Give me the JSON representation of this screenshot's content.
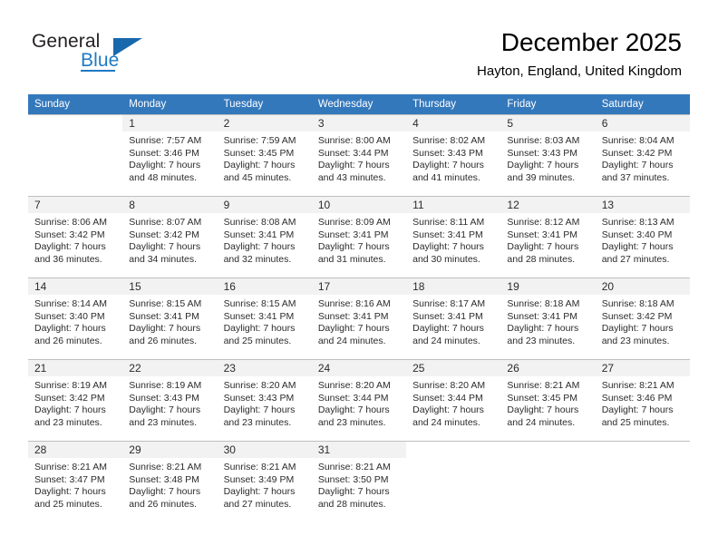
{
  "brand": {
    "name_part1": "General",
    "name_part2": "Blue",
    "logo_icon": "triangle-logo-icon",
    "accent_color": "#1868ad"
  },
  "header": {
    "month_title": "December 2025",
    "location": "Hayton, England, United Kingdom"
  },
  "theme": {
    "header_row_bg": "#3478bc",
    "header_row_text": "#ffffff",
    "daynum_bar_bg": "#f2f2f2",
    "grid_line": "#c8c8c8",
    "body_text": "#2b2b2b"
  },
  "weekday_headers": [
    "Sunday",
    "Monday",
    "Tuesday",
    "Wednesday",
    "Thursday",
    "Friday",
    "Saturday"
  ],
  "weeks": [
    [
      {
        "day": "",
        "empty": true,
        "sunrise": "",
        "sunset": "",
        "daylight_line1": "",
        "daylight_line2": ""
      },
      {
        "day": "1",
        "empty": false,
        "sunrise": "Sunrise: 7:57 AM",
        "sunset": "Sunset: 3:46 PM",
        "daylight_line1": "Daylight: 7 hours",
        "daylight_line2": "and 48 minutes."
      },
      {
        "day": "2",
        "empty": false,
        "sunrise": "Sunrise: 7:59 AM",
        "sunset": "Sunset: 3:45 PM",
        "daylight_line1": "Daylight: 7 hours",
        "daylight_line2": "and 45 minutes."
      },
      {
        "day": "3",
        "empty": false,
        "sunrise": "Sunrise: 8:00 AM",
        "sunset": "Sunset: 3:44 PM",
        "daylight_line1": "Daylight: 7 hours",
        "daylight_line2": "and 43 minutes."
      },
      {
        "day": "4",
        "empty": false,
        "sunrise": "Sunrise: 8:02 AM",
        "sunset": "Sunset: 3:43 PM",
        "daylight_line1": "Daylight: 7 hours",
        "daylight_line2": "and 41 minutes."
      },
      {
        "day": "5",
        "empty": false,
        "sunrise": "Sunrise: 8:03 AM",
        "sunset": "Sunset: 3:43 PM",
        "daylight_line1": "Daylight: 7 hours",
        "daylight_line2": "and 39 minutes."
      },
      {
        "day": "6",
        "empty": false,
        "sunrise": "Sunrise: 8:04 AM",
        "sunset": "Sunset: 3:42 PM",
        "daylight_line1": "Daylight: 7 hours",
        "daylight_line2": "and 37 minutes."
      }
    ],
    [
      {
        "day": "7",
        "empty": false,
        "sunrise": "Sunrise: 8:06 AM",
        "sunset": "Sunset: 3:42 PM",
        "daylight_line1": "Daylight: 7 hours",
        "daylight_line2": "and 36 minutes."
      },
      {
        "day": "8",
        "empty": false,
        "sunrise": "Sunrise: 8:07 AM",
        "sunset": "Sunset: 3:42 PM",
        "daylight_line1": "Daylight: 7 hours",
        "daylight_line2": "and 34 minutes."
      },
      {
        "day": "9",
        "empty": false,
        "sunrise": "Sunrise: 8:08 AM",
        "sunset": "Sunset: 3:41 PM",
        "daylight_line1": "Daylight: 7 hours",
        "daylight_line2": "and 32 minutes."
      },
      {
        "day": "10",
        "empty": false,
        "sunrise": "Sunrise: 8:09 AM",
        "sunset": "Sunset: 3:41 PM",
        "daylight_line1": "Daylight: 7 hours",
        "daylight_line2": "and 31 minutes."
      },
      {
        "day": "11",
        "empty": false,
        "sunrise": "Sunrise: 8:11 AM",
        "sunset": "Sunset: 3:41 PM",
        "daylight_line1": "Daylight: 7 hours",
        "daylight_line2": "and 30 minutes."
      },
      {
        "day": "12",
        "empty": false,
        "sunrise": "Sunrise: 8:12 AM",
        "sunset": "Sunset: 3:41 PM",
        "daylight_line1": "Daylight: 7 hours",
        "daylight_line2": "and 28 minutes."
      },
      {
        "day": "13",
        "empty": false,
        "sunrise": "Sunrise: 8:13 AM",
        "sunset": "Sunset: 3:40 PM",
        "daylight_line1": "Daylight: 7 hours",
        "daylight_line2": "and 27 minutes."
      }
    ],
    [
      {
        "day": "14",
        "empty": false,
        "sunrise": "Sunrise: 8:14 AM",
        "sunset": "Sunset: 3:40 PM",
        "daylight_line1": "Daylight: 7 hours",
        "daylight_line2": "and 26 minutes."
      },
      {
        "day": "15",
        "empty": false,
        "sunrise": "Sunrise: 8:15 AM",
        "sunset": "Sunset: 3:41 PM",
        "daylight_line1": "Daylight: 7 hours",
        "daylight_line2": "and 26 minutes."
      },
      {
        "day": "16",
        "empty": false,
        "sunrise": "Sunrise: 8:15 AM",
        "sunset": "Sunset: 3:41 PM",
        "daylight_line1": "Daylight: 7 hours",
        "daylight_line2": "and 25 minutes."
      },
      {
        "day": "17",
        "empty": false,
        "sunrise": "Sunrise: 8:16 AM",
        "sunset": "Sunset: 3:41 PM",
        "daylight_line1": "Daylight: 7 hours",
        "daylight_line2": "and 24 minutes."
      },
      {
        "day": "18",
        "empty": false,
        "sunrise": "Sunrise: 8:17 AM",
        "sunset": "Sunset: 3:41 PM",
        "daylight_line1": "Daylight: 7 hours",
        "daylight_line2": "and 24 minutes."
      },
      {
        "day": "19",
        "empty": false,
        "sunrise": "Sunrise: 8:18 AM",
        "sunset": "Sunset: 3:41 PM",
        "daylight_line1": "Daylight: 7 hours",
        "daylight_line2": "and 23 minutes."
      },
      {
        "day": "20",
        "empty": false,
        "sunrise": "Sunrise: 8:18 AM",
        "sunset": "Sunset: 3:42 PM",
        "daylight_line1": "Daylight: 7 hours",
        "daylight_line2": "and 23 minutes."
      }
    ],
    [
      {
        "day": "21",
        "empty": false,
        "sunrise": "Sunrise: 8:19 AM",
        "sunset": "Sunset: 3:42 PM",
        "daylight_line1": "Daylight: 7 hours",
        "daylight_line2": "and 23 minutes."
      },
      {
        "day": "22",
        "empty": false,
        "sunrise": "Sunrise: 8:19 AM",
        "sunset": "Sunset: 3:43 PM",
        "daylight_line1": "Daylight: 7 hours",
        "daylight_line2": "and 23 minutes."
      },
      {
        "day": "23",
        "empty": false,
        "sunrise": "Sunrise: 8:20 AM",
        "sunset": "Sunset: 3:43 PM",
        "daylight_line1": "Daylight: 7 hours",
        "daylight_line2": "and 23 minutes."
      },
      {
        "day": "24",
        "empty": false,
        "sunrise": "Sunrise: 8:20 AM",
        "sunset": "Sunset: 3:44 PM",
        "daylight_line1": "Daylight: 7 hours",
        "daylight_line2": "and 23 minutes."
      },
      {
        "day": "25",
        "empty": false,
        "sunrise": "Sunrise: 8:20 AM",
        "sunset": "Sunset: 3:44 PM",
        "daylight_line1": "Daylight: 7 hours",
        "daylight_line2": "and 24 minutes."
      },
      {
        "day": "26",
        "empty": false,
        "sunrise": "Sunrise: 8:21 AM",
        "sunset": "Sunset: 3:45 PM",
        "daylight_line1": "Daylight: 7 hours",
        "daylight_line2": "and 24 minutes."
      },
      {
        "day": "27",
        "empty": false,
        "sunrise": "Sunrise: 8:21 AM",
        "sunset": "Sunset: 3:46 PM",
        "daylight_line1": "Daylight: 7 hours",
        "daylight_line2": "and 25 minutes."
      }
    ],
    [
      {
        "day": "28",
        "empty": false,
        "sunrise": "Sunrise: 8:21 AM",
        "sunset": "Sunset: 3:47 PM",
        "daylight_line1": "Daylight: 7 hours",
        "daylight_line2": "and 25 minutes."
      },
      {
        "day": "29",
        "empty": false,
        "sunrise": "Sunrise: 8:21 AM",
        "sunset": "Sunset: 3:48 PM",
        "daylight_line1": "Daylight: 7 hours",
        "daylight_line2": "and 26 minutes."
      },
      {
        "day": "30",
        "empty": false,
        "sunrise": "Sunrise: 8:21 AM",
        "sunset": "Sunset: 3:49 PM",
        "daylight_line1": "Daylight: 7 hours",
        "daylight_line2": "and 27 minutes."
      },
      {
        "day": "31",
        "empty": false,
        "sunrise": "Sunrise: 8:21 AM",
        "sunset": "Sunset: 3:50 PM",
        "daylight_line1": "Daylight: 7 hours",
        "daylight_line2": "and 28 minutes."
      },
      {
        "day": "",
        "empty": true,
        "sunrise": "",
        "sunset": "",
        "daylight_line1": "",
        "daylight_line2": ""
      },
      {
        "day": "",
        "empty": true,
        "sunrise": "",
        "sunset": "",
        "daylight_line1": "",
        "daylight_line2": ""
      },
      {
        "day": "",
        "empty": true,
        "sunrise": "",
        "sunset": "",
        "daylight_line1": "",
        "daylight_line2": ""
      }
    ]
  ]
}
